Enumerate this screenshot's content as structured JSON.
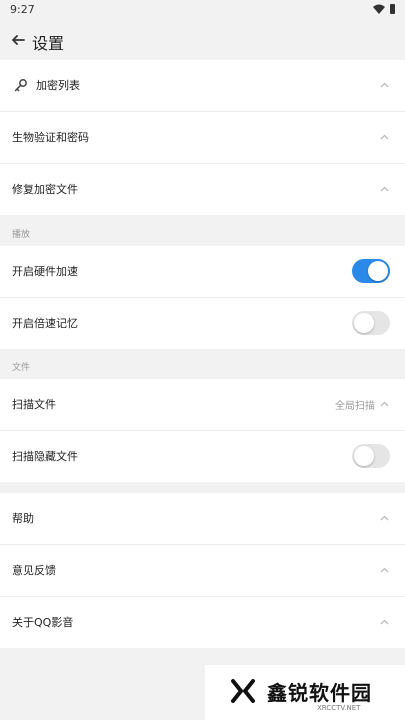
{
  "status_bar": {
    "time": "9:27"
  },
  "header": {
    "title": "设置"
  },
  "group1": {
    "items": [
      {
        "label": "加密列表"
      },
      {
        "label": "生物验证和密码"
      },
      {
        "label": "修复加密文件"
      }
    ]
  },
  "playback": {
    "header": "播放",
    "items": [
      {
        "label": "开启硬件加速",
        "toggle": "on"
      },
      {
        "label": "开启倍速记忆",
        "toggle": "off"
      }
    ]
  },
  "files": {
    "header": "文件",
    "items": [
      {
        "label": "扫描文件",
        "value": "全局扫描"
      },
      {
        "label": "扫描隐藏文件",
        "toggle": "off"
      }
    ]
  },
  "group4": {
    "items": [
      {
        "label": "帮助"
      },
      {
        "label": "意见反馈"
      },
      {
        "label": "关于QQ影音"
      }
    ]
  },
  "watermark": {
    "title": "鑫锐软件园",
    "subtitle": "XRCCTV.NET"
  },
  "colors": {
    "accent": "#2b8ae7",
    "background": "#f2f2f2"
  }
}
